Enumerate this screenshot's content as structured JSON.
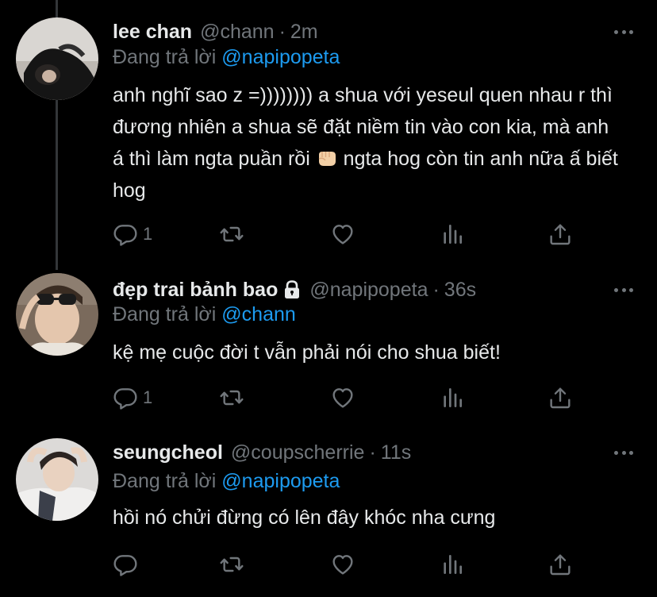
{
  "colors": {
    "background": "#000000",
    "text": "#e7e9ea",
    "muted": "#71767b",
    "mention": "#1d9bf0",
    "thread_line": "#333639"
  },
  "tweets": [
    {
      "name": "lee chan",
      "handle": "@chann",
      "separator": "·",
      "time": "2m",
      "reply_prefix": "Đang trả lời",
      "reply_mention": "@napipopeta",
      "text_part1": "anh nghĩ sao z =)))))))) a shua với yeseul quen nhau r thì đương nhiên a shua sẽ đặt niềm tin vào con kia, mà anh á thì làm ngta puần rồi",
      "emoji": "fist-emoji",
      "text_part2": " ngta hog còn tin anh nữa ấ biết hog",
      "reply_count": "1"
    },
    {
      "name": "đẹp trai bảnh bao",
      "handle": "@napipopeta",
      "separator": "·",
      "time": "36s",
      "reply_prefix": "Đang trả lời",
      "reply_mention": "@chann",
      "text": "kệ mẹ cuộc đời t vẫn phải nói cho shua biết!",
      "reply_count": "1"
    },
    {
      "name": "seungcheol",
      "handle": "@coupscherrie",
      "separator": "·",
      "time": "11s",
      "reply_prefix": "Đang trả lời",
      "reply_mention": "@napipopeta",
      "text": "hồi nó chửi đừng có lên đây khóc nha cưng",
      "reply_count": ""
    }
  ],
  "icons": [
    "reply-icon",
    "retweet-icon",
    "like-icon",
    "analytics-icon",
    "share-icon",
    "more-icon",
    "lock-icon"
  ]
}
